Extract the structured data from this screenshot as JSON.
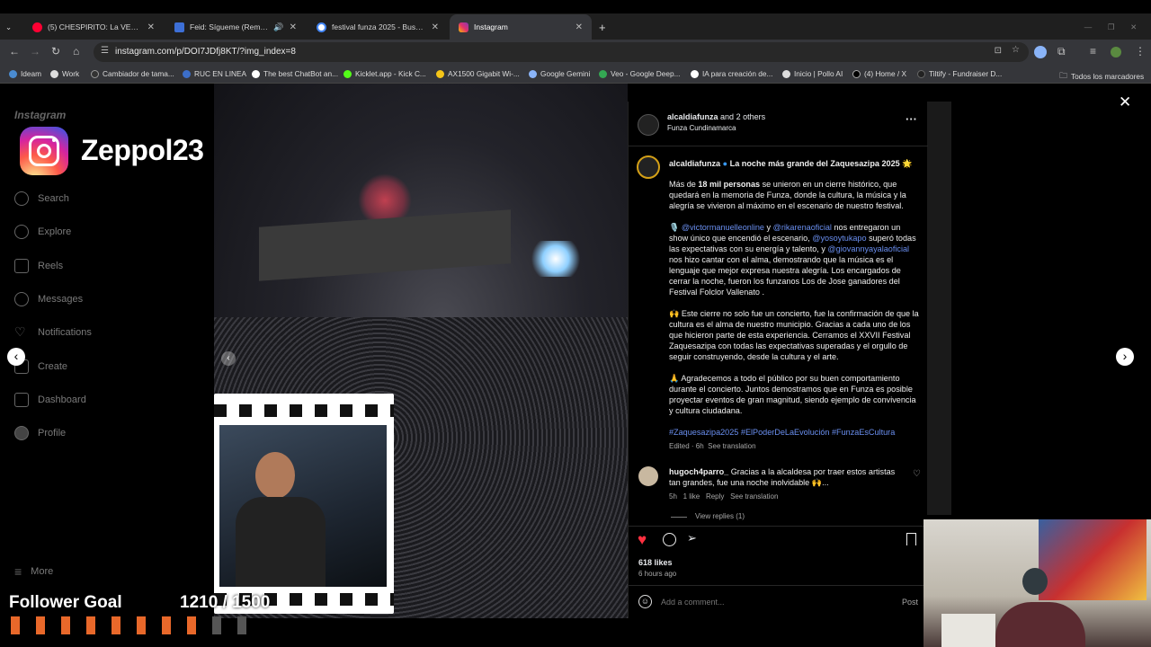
{
  "browser": {
    "tabs": [
      {
        "title": "(5) CHESPIRITO: La VERDAD qu",
        "fav_color": "#ff0033"
      },
      {
        "title": "Feid: Sígueme (Remix) - Jar",
        "fav_color": "#3d6fd6"
      },
      {
        "title": "festival funza 2025 - Buscar co",
        "fav_color": "#4285f4"
      },
      {
        "title": "Instagram",
        "fav_color": "#e1306c"
      }
    ],
    "url": "instagram.com/p/DOI7JDfj8KT/?img_index=8",
    "bookmarks": [
      "Ideam",
      "Work",
      "Cambiador de tama...",
      "RUC EN LINEA",
      "The best ChatBot an...",
      "Kicklet.app - Kick C...",
      "AX1500 Gigabit Wi-...",
      "Google Gemini",
      "Veo - Google Deep...",
      "IA para creación de...",
      "Inicio | Pollo AI",
      "(4) Home / X",
      "Tiltify - Fundraiser D..."
    ],
    "all_bookmarks": "Todos los marcadores"
  },
  "overlay": {
    "instagram_wordmark": "Instagram",
    "channel_name": "Zeppol23",
    "follower_goal_label": "Follower Goal",
    "follower_goal_count": "1210 / 1500",
    "follower_goal_progress": 0.807
  },
  "sidebar": {
    "items": [
      {
        "label": "Search",
        "icon": "search-icon"
      },
      {
        "label": "Explore",
        "icon": "compass-icon"
      },
      {
        "label": "Reels",
        "icon": "reels-icon"
      },
      {
        "label": "Messages",
        "icon": "messenger-icon"
      },
      {
        "label": "Notifications",
        "icon": "heart-icon"
      },
      {
        "label": "Create",
        "icon": "plus-icon"
      },
      {
        "label": "Dashboard",
        "icon": "chart-icon"
      },
      {
        "label": "Profile",
        "icon": "avatar-icon"
      }
    ],
    "more": "More"
  },
  "post": {
    "author": "alcaldiafunza",
    "coauthors": "and 2 others",
    "location": "Funza Cundinamarca",
    "caption_title": "La noche más grande del Zaquesazipa 2025 🌟",
    "p1_a": "Más de ",
    "p1_bold": "18 mil personas",
    "p1_b": " se unieron en un cierre histórico, que quedará en la memoria de Funza, donde la cultura, la música y la alegría se vivieron al máximo en el escenario de nuestro festival.",
    "p2_m1": "@victormanuelleonline",
    "p2_y": " y ",
    "p2_m2": "@rikarenaoficial",
    "p2_a": " nos entregaron un show único que encendió el escenario, ",
    "p2_m3": "@yosoytukapo",
    "p2_b": " superó todas las expectativas con su energía y talento, y ",
    "p2_m4": "@giovannyayalaoficial",
    "p2_c": " nos hizo cantar con el alma, demostrando que la música es el lenguaje que mejor expresa nuestra alegría. Los encargados de cerrar la noche, fueron los funzanos Los de Jose ganadores del Festival Folclor Vallenato .",
    "p3": "🙌 Este cierre no solo fue un concierto, fue la confirmación de que la cultura es el alma de nuestro municipio. Gracias a cada uno de los que hicieron parte de esta experiencia. Cerramos el XXVII Festival Zaquesazipa con todas las expectativas superadas y el orgullo de seguir construyendo, desde la cultura y el arte.",
    "p4": "🙏 Agradecemos a todo el público por su buen comportamiento durante el concierto. Juntos demostramos que en Funza es posible proyectar eventos de gran magnitud, siendo ejemplo de convivencia y cultura ciudadana.",
    "hashtags": "#Zaquesazipa2025 #ElPoderDeLaEvolución #FunzaEsCultura",
    "edited": "Edited · 6h",
    "see_translation": "See translation",
    "comment": {
      "user": "hugoch4parro_",
      "text": "Gracias a la alcaldesa por traer estos artistas tan grandes, fue una noche inolvidable 🙌...",
      "time": "5h",
      "likes": "1 like",
      "reply": "Reply",
      "see_translation": "See translation",
      "view_replies": "View replies (1)"
    },
    "likes": "618 likes",
    "time_ago": "6 hours ago",
    "add_comment_placeholder": "Add a comment...",
    "post_button": "Post"
  }
}
